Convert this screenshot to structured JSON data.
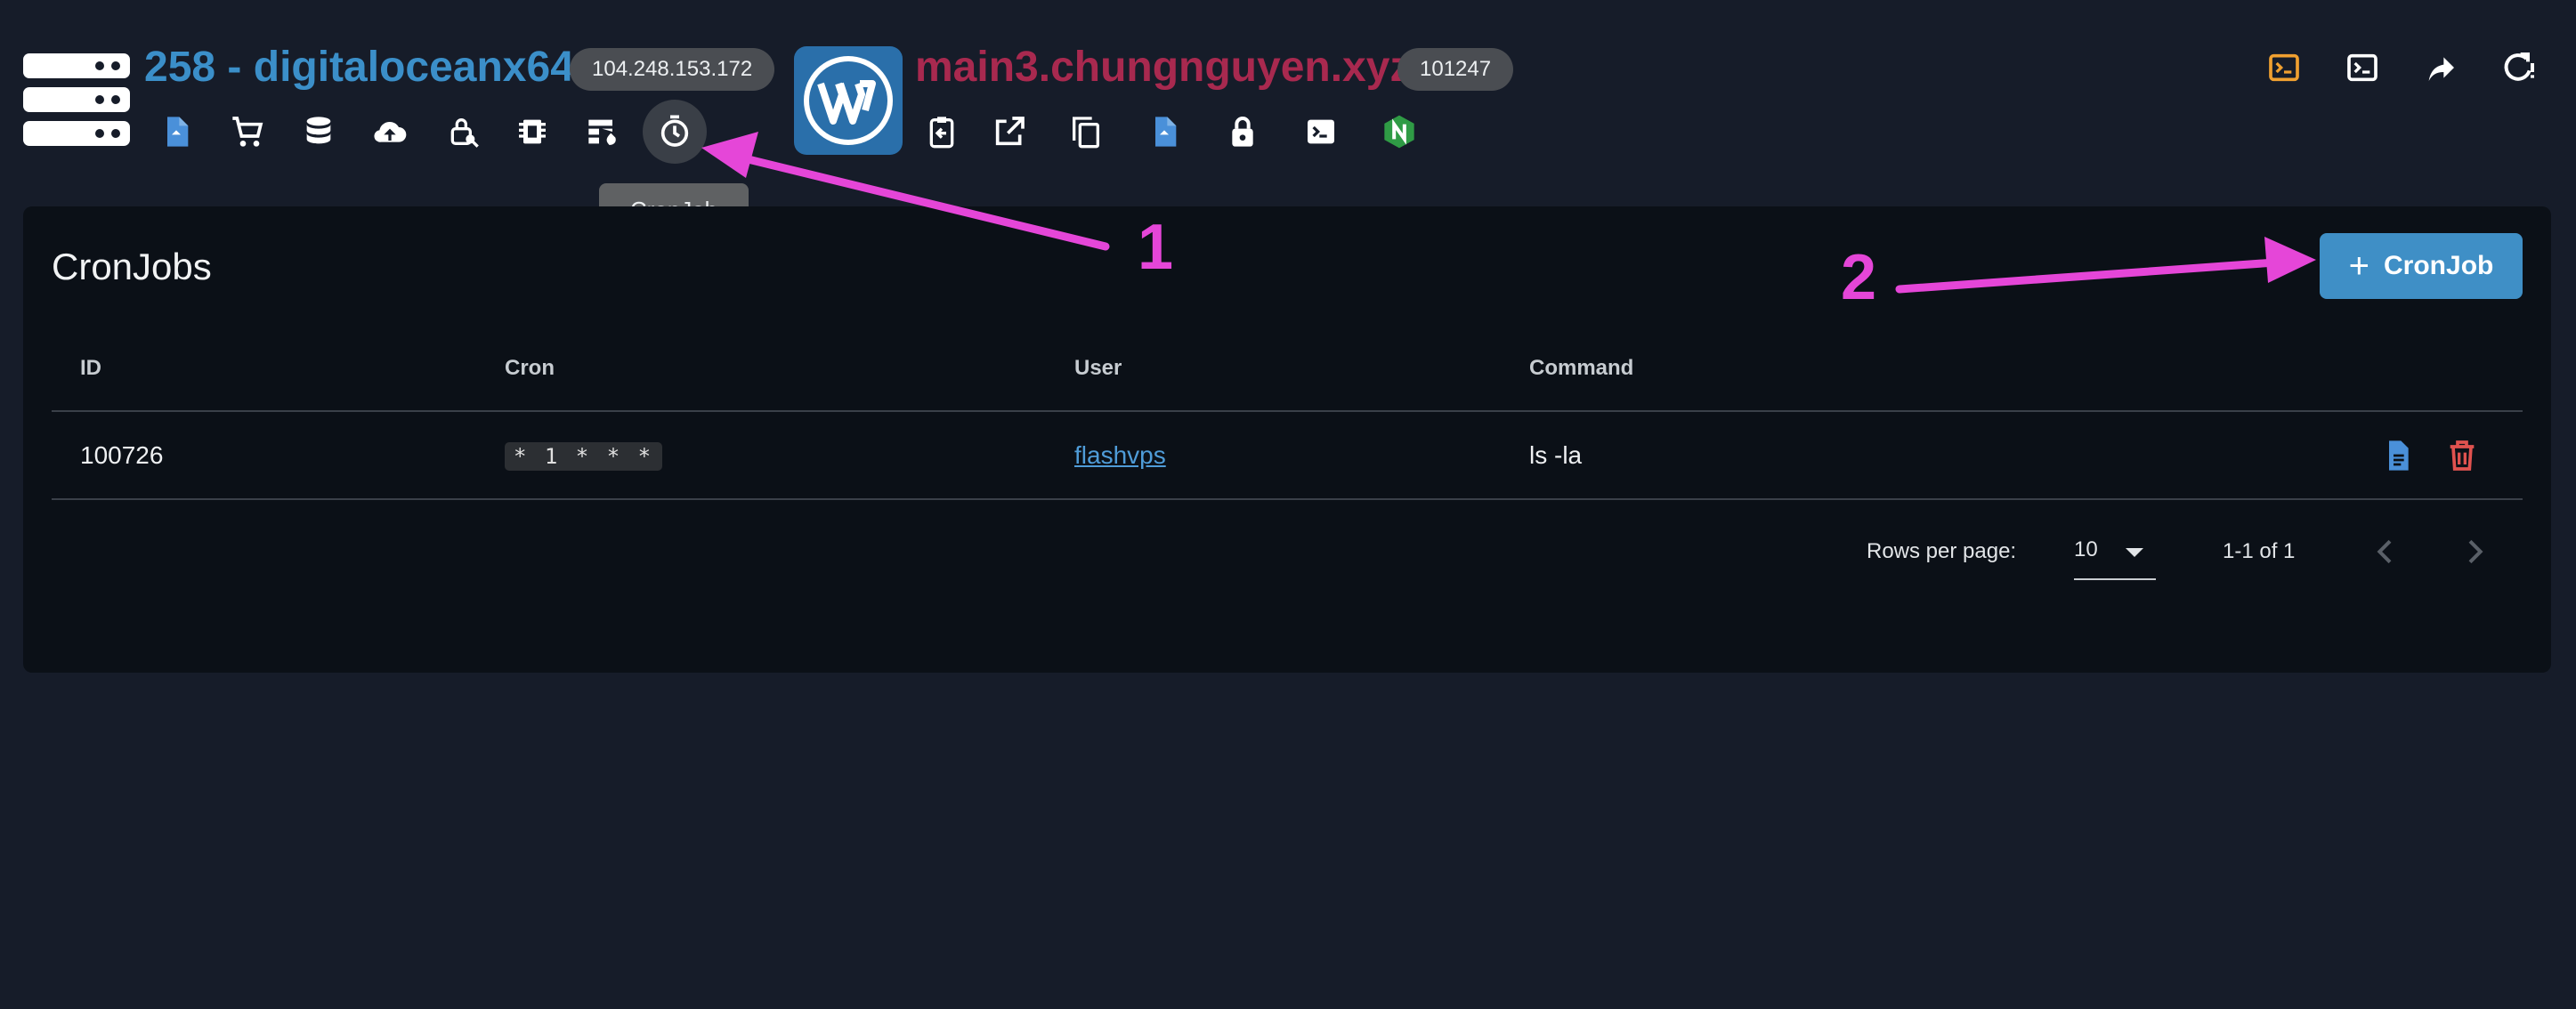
{
  "server": {
    "title": "258 - digitaloceanx64",
    "ip": "104.248.153.172"
  },
  "site": {
    "title": "main3.chungnguyen.xyz",
    "id": "101247"
  },
  "server_toolbar": [
    "file-icon",
    "cart-icon",
    "database-icon",
    "cloud-upload-icon",
    "key-icon",
    "chip-icon",
    "firewall-icon",
    "cronjob-icon"
  ],
  "site_toolbar": [
    "clipboard-icon",
    "external-link-icon",
    "copy-icon",
    "file-icon",
    "lock-icon",
    "terminal-icon",
    "nginx-icon"
  ],
  "header_actions": [
    "console-icon",
    "terminal-icon",
    "share-icon",
    "restart-icon"
  ],
  "tooltip": "CronJob",
  "card": {
    "title": "CronJobs",
    "add_button": "CronJob",
    "columns": [
      "ID",
      "Cron",
      "User",
      "Command"
    ],
    "rows": [
      {
        "id": "100726",
        "cron": "* 1 * * *",
        "user": "flashvps",
        "command": "ls -la"
      }
    ],
    "footer": {
      "rows_per_page_label": "Rows per page:",
      "rows_per_page_value": "10",
      "range": "1-1 of 1"
    }
  },
  "annotations": {
    "one": "1",
    "two": "2"
  },
  "colors": {
    "accent": "#3f8fc6",
    "annotation": "#e546d8",
    "site_title": "#a8294f",
    "delete": "#e0524f",
    "console": "#f0a030"
  }
}
